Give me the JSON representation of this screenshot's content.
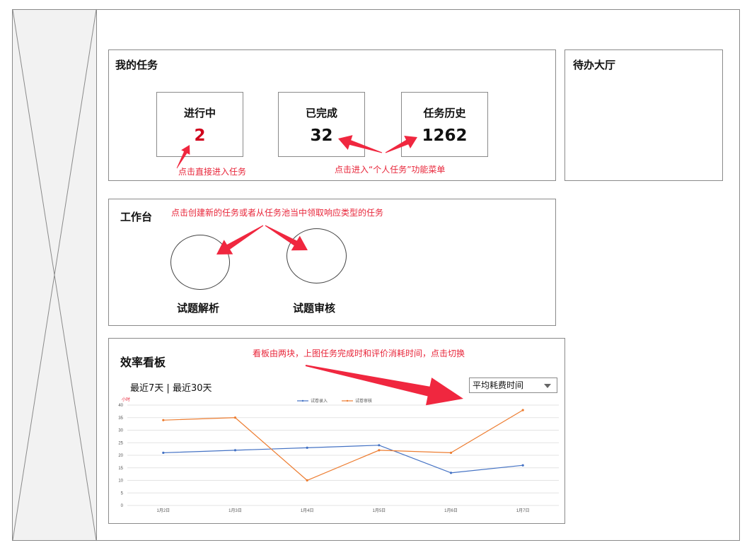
{
  "my_tasks": {
    "title": "我的任务",
    "stats": [
      {
        "label": "进行中",
        "value": "2",
        "color": "#d0021b"
      },
      {
        "label": "已完成",
        "value": "32",
        "color": "#111111"
      },
      {
        "label": "任务历史",
        "value": "1262",
        "color": "#111111"
      }
    ],
    "annot_enter": "点击直接进入任务",
    "annot_menu": "点击进入“个人任务”功能菜单"
  },
  "todo_hall": {
    "title": "待办大厅"
  },
  "workbench": {
    "title": "工作台",
    "annot": "点击创建新的任务或者从任务池当中领取响应类型的任务",
    "items": [
      {
        "label": "试题解析"
      },
      {
        "label": "试题审核"
      }
    ]
  },
  "efficiency": {
    "title": "效率看板",
    "annot": "看板由两块，上图任务完成时和评价消耗时间，点击切换",
    "range_7": "最近7天",
    "range_sep": "|",
    "range_30": "最近30天",
    "dropdown_value": "平均耗费时间"
  },
  "chart_data": {
    "type": "line",
    "unit_label": "小时",
    "categories": [
      "1月2日",
      "1月3日",
      "1月4日",
      "1月5日",
      "1月6日",
      "1月7日"
    ],
    "ylim": [
      0,
      40
    ],
    "yticks": [
      0,
      5,
      10,
      15,
      20,
      25,
      30,
      35,
      40
    ],
    "grid": true,
    "legend_position": "top-center",
    "series": [
      {
        "name": "试卷录入",
        "color": "#4472c4",
        "values": [
          21,
          22,
          23,
          24,
          13,
          16
        ]
      },
      {
        "name": "试卷审核",
        "color": "#ed7d31",
        "values": [
          34,
          35,
          10,
          22,
          21,
          38
        ]
      }
    ]
  },
  "colors": {
    "annotation": "#e8263a",
    "arrow": "#f0273f"
  }
}
